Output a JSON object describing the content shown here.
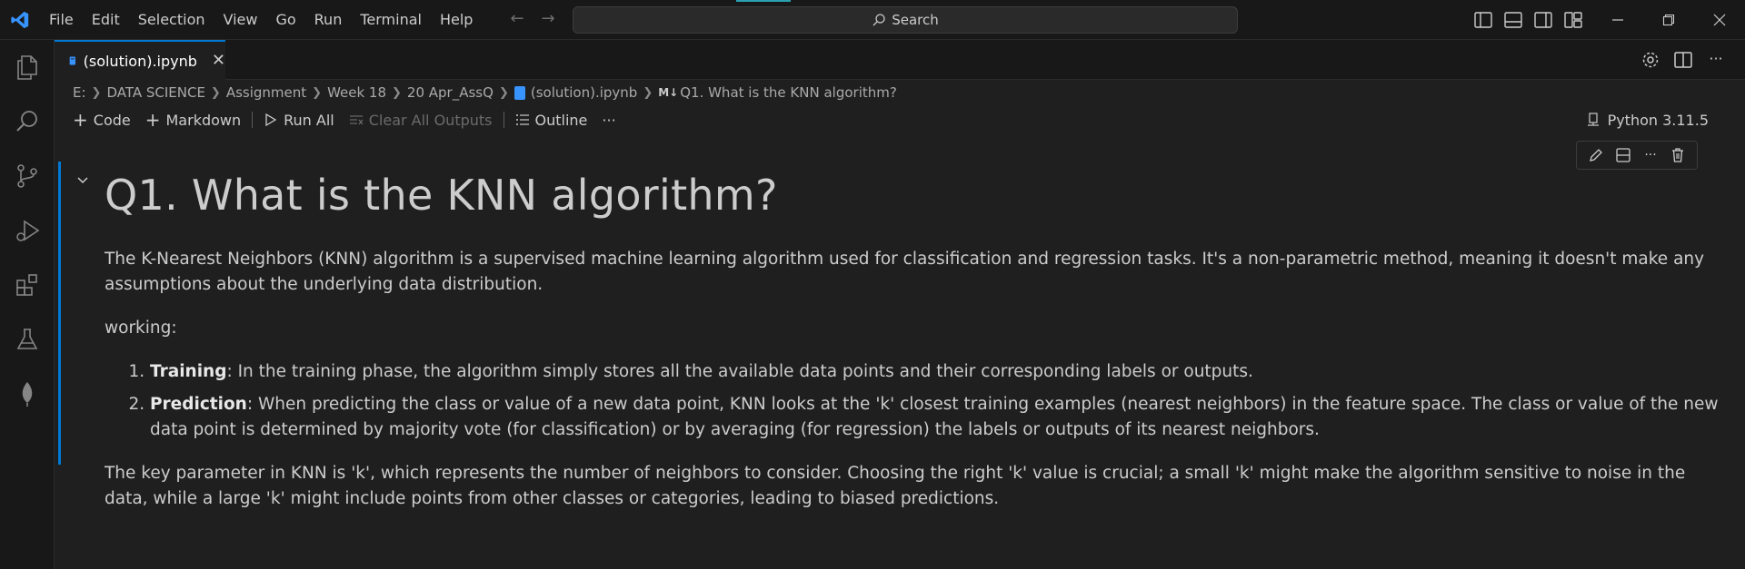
{
  "menu": [
    "File",
    "Edit",
    "Selection",
    "View",
    "Go",
    "Run",
    "Terminal",
    "Help"
  ],
  "search": {
    "label": "Search"
  },
  "tab": {
    "label": "(solution).ipynb",
    "close": "✕"
  },
  "breadcrumb": {
    "items": [
      "E:",
      "DATA SCIENCE",
      "Assignment",
      "Week 18",
      "20 Apr_AssQ"
    ],
    "file": "(solution).ipynb",
    "md_badge": "M↓",
    "heading": "Q1. What is the KNN algorithm?"
  },
  "toolbar": {
    "code": "Code",
    "markdown": "Markdown",
    "run_all": "Run All",
    "clear_outputs": "Clear All Outputs",
    "outline": "Outline",
    "more": "···"
  },
  "kernel": {
    "label": "Python 3.11.5"
  },
  "cell": {
    "heading": "Q1. What is the KNN algorithm?",
    "intro": "The K-Nearest Neighbors (KNN) algorithm is a supervised machine learning algorithm used for classification and regression tasks. It's a non-parametric method, meaning it doesn't make any assumptions about the underlying data distribution.",
    "working_label": "working:",
    "steps": [
      {
        "term": "Training",
        "text": ": In the training phase, the algorithm simply stores all the available data points and their corresponding labels or outputs."
      },
      {
        "term": "Prediction",
        "text": ": When predicting the class or value of a new data point, KNN looks at the 'k' closest training examples (nearest neighbors) in the feature space. The class or value of the new data point is determined by majority vote (for classification) or by averaging (for regression) the labels or outputs of its nearest neighbors."
      }
    ],
    "closing": "The key parameter in KNN is 'k', which represents the number of neighbors to consider. Choosing the right 'k' value is crucial; a small 'k' might make the algorithm sensitive to noise in the data, while a large 'k' might include points from other classes or categories, leading to biased predictions."
  },
  "colors": {
    "accent": "#0078d4",
    "background": "#1f1f1f",
    "sidebar": "#181818",
    "text": "#cccccc"
  }
}
